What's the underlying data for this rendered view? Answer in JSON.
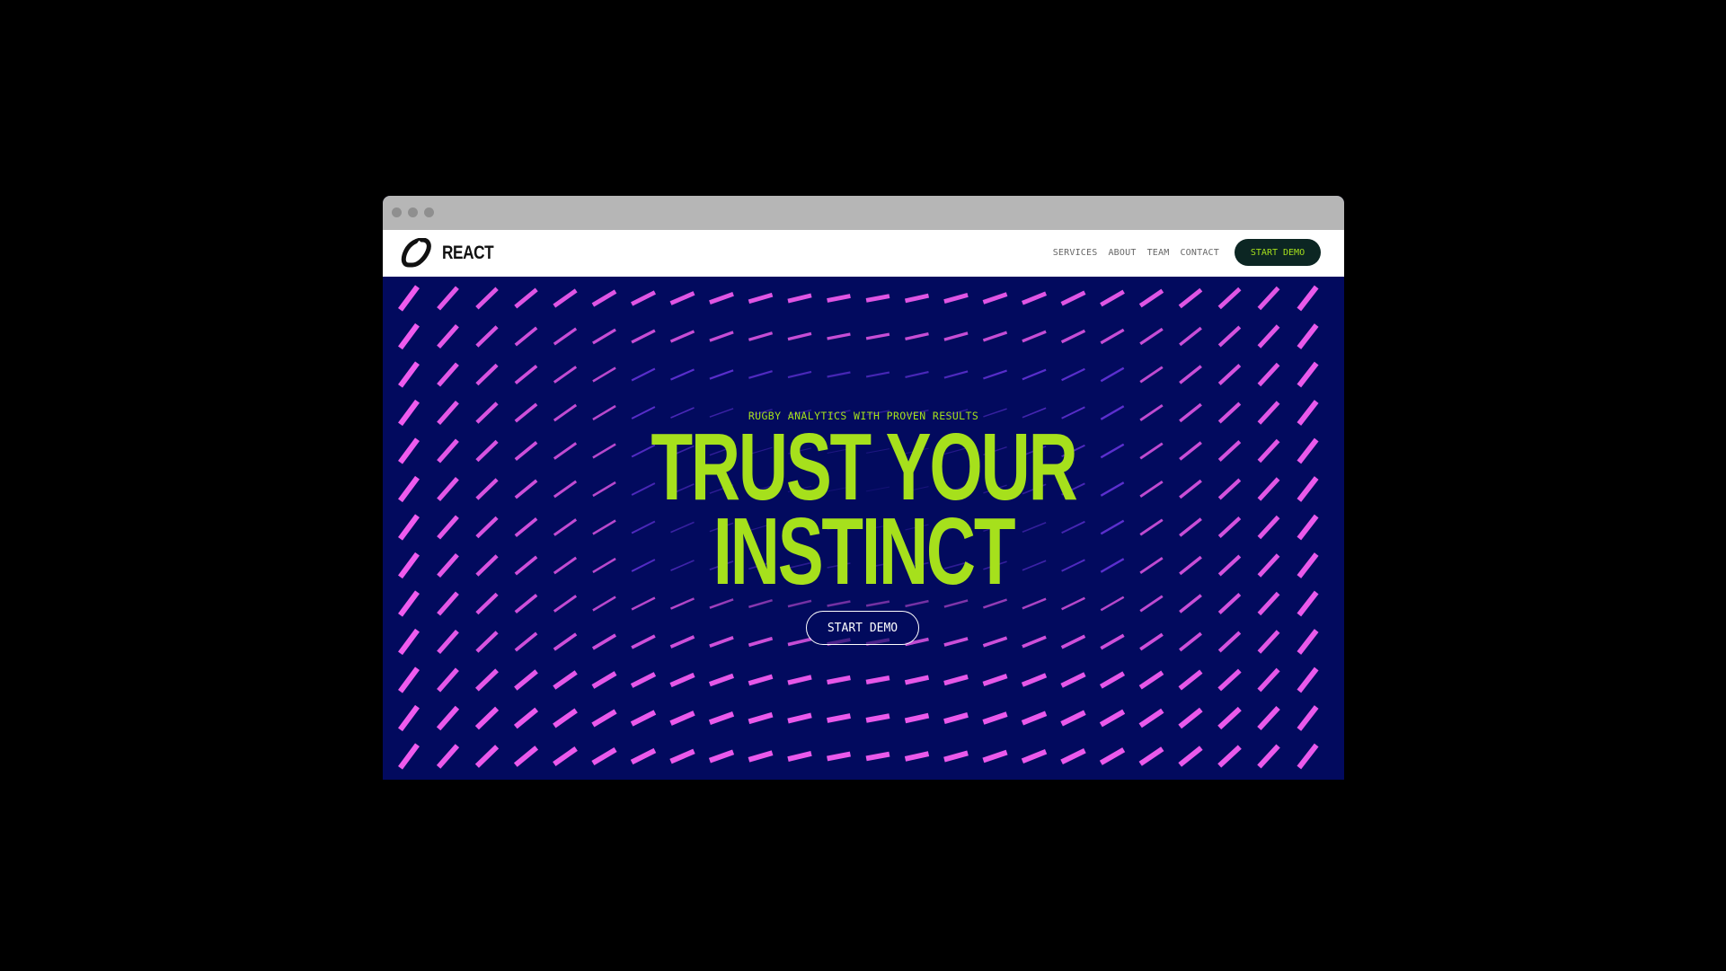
{
  "browser": {
    "window_dots": [
      "close-dot",
      "minimize-dot",
      "maximize-dot"
    ]
  },
  "nav": {
    "brand": "REACT",
    "logo_icon": "react-logo-icon",
    "links": [
      "SERVICES",
      "ABOUT",
      "TEAM",
      "CONTACT"
    ],
    "cta": "START DEMO"
  },
  "hero": {
    "eyebrow": "RUGBY ANALYTICS WITH PROVEN RESULTS",
    "headline_line1": "TRUST YOUR",
    "headline_line2": "INSTINCT",
    "cta": "START DEMO"
  },
  "colors": {
    "page_background": "#000000",
    "hero_background": "#020a5e",
    "accent_green": "#a6e01c",
    "pattern_magenta": "#f25cf0",
    "pattern_violet": "#7a3cf5",
    "nav_cta_background": "#0c2623"
  }
}
